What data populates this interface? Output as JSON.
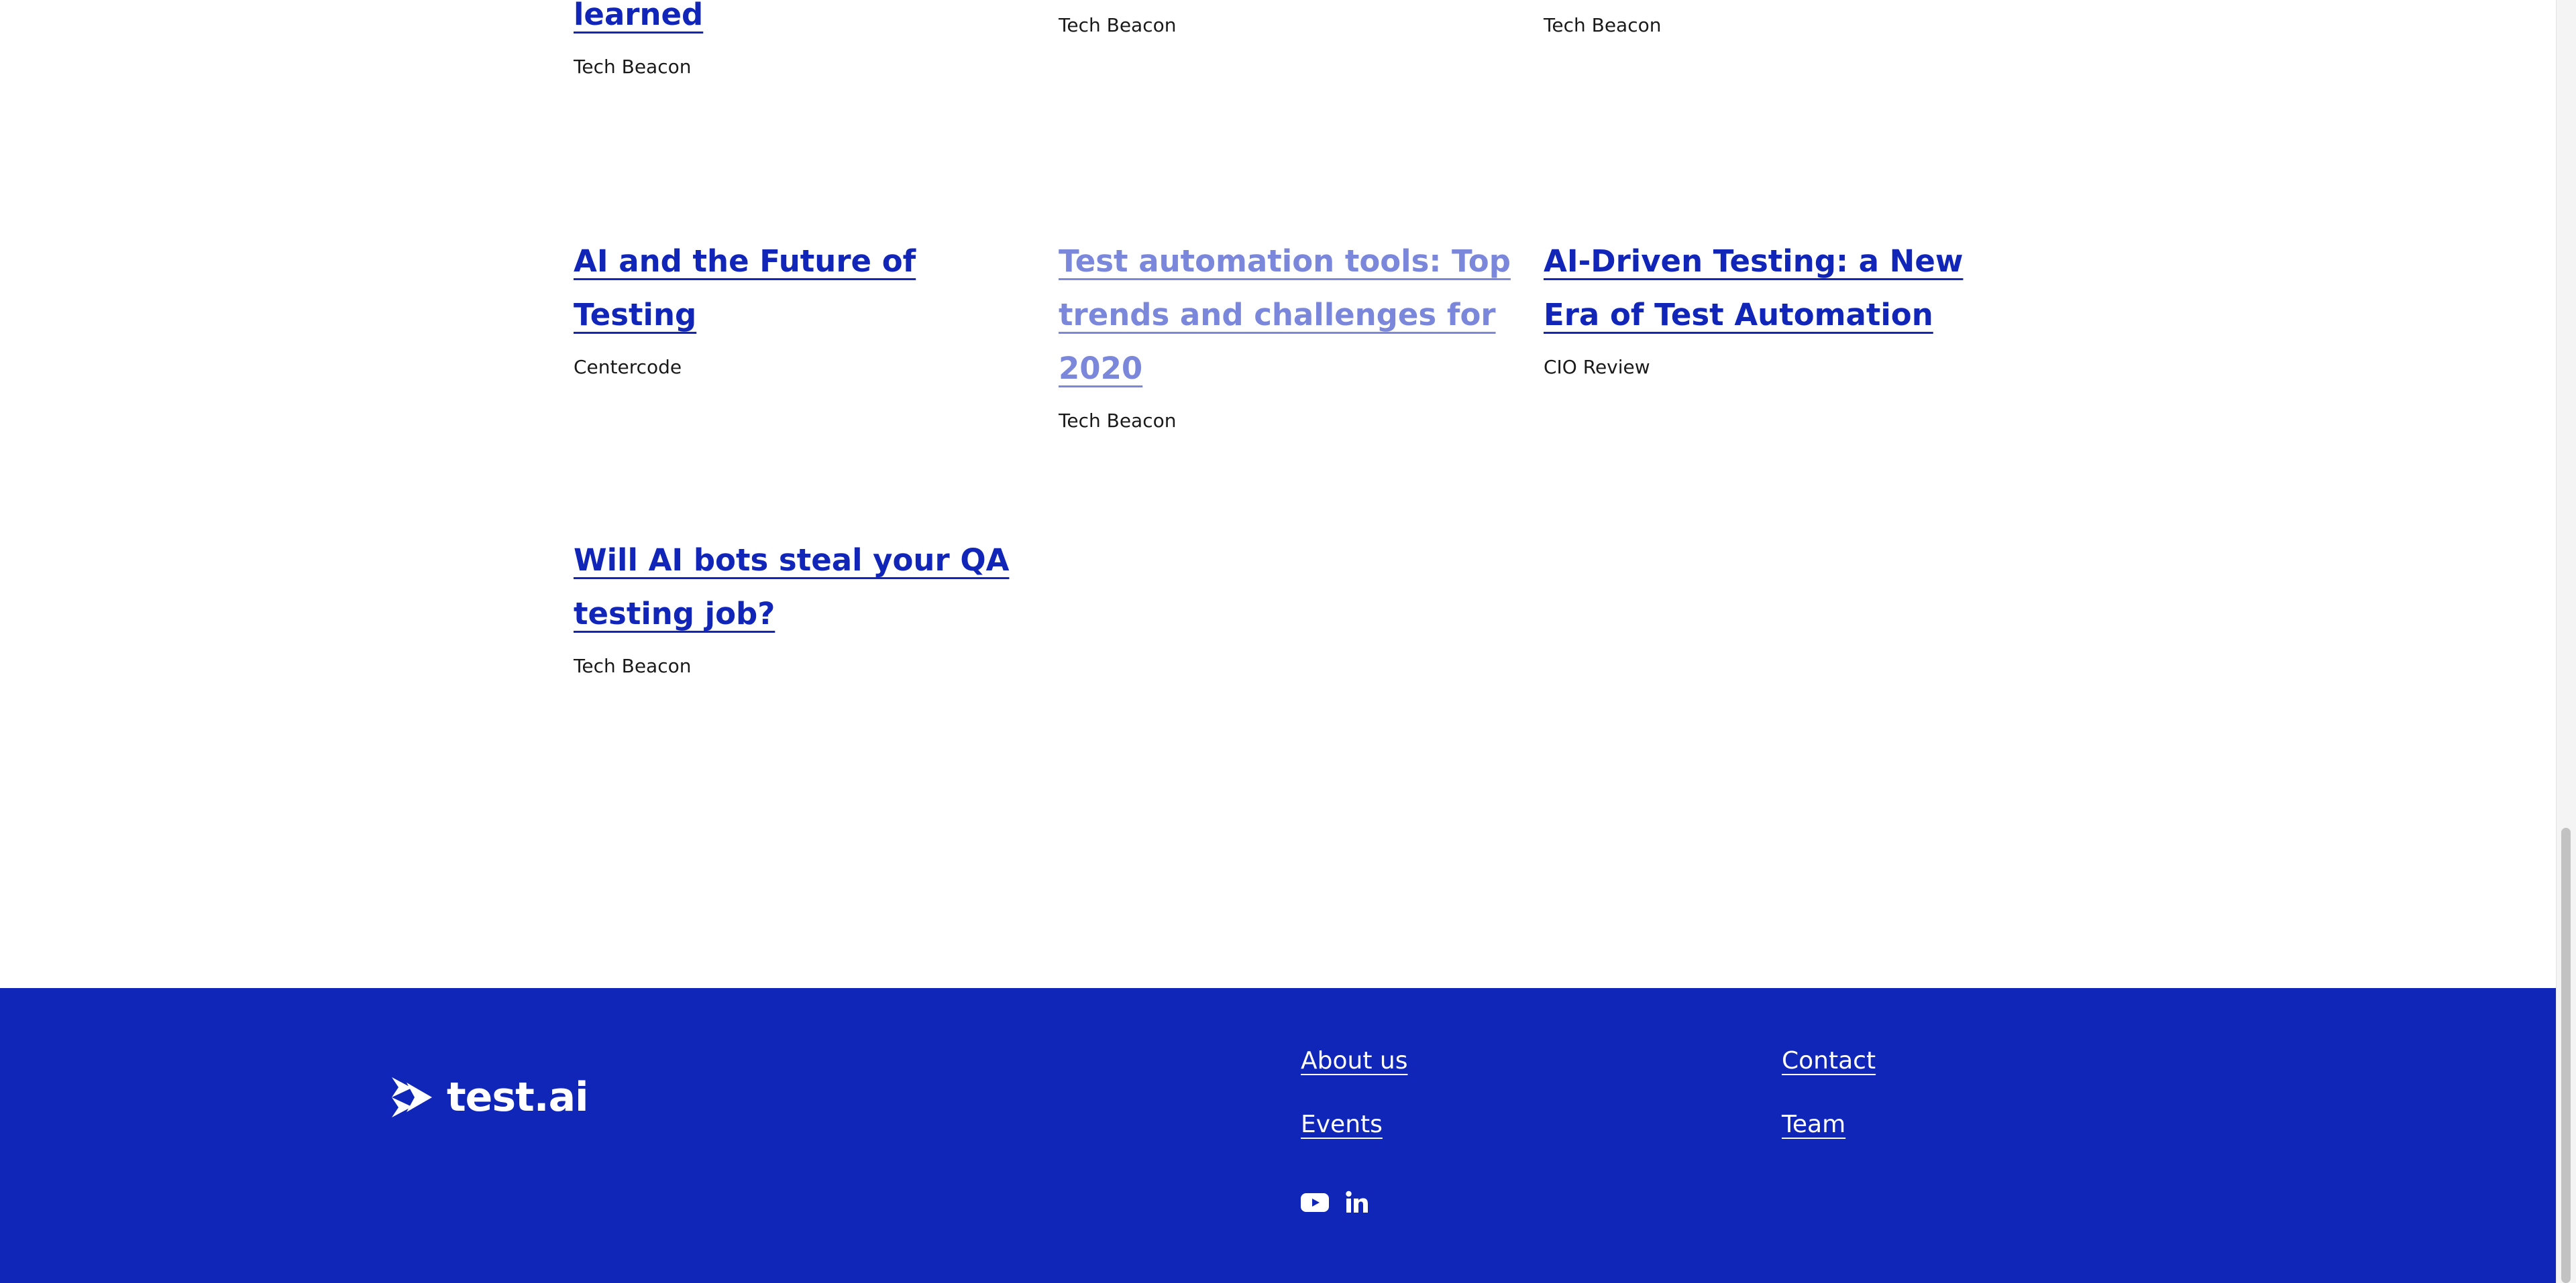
{
  "articles": [
    {
      "title": "learned",
      "source": "Tech Beacon"
    },
    {
      "title": "",
      "source": "Tech Beacon"
    },
    {
      "title": "",
      "source": "Tech Beacon"
    },
    {
      "title": "AI and the Future of Testing",
      "source": "Centercode"
    },
    {
      "title": "Test automation tools: Top trends and challenges for 2020",
      "source": "Tech Beacon",
      "visited": true
    },
    {
      "title": "AI-Driven Testing: a New Era of Test Automation",
      "source": "CIO Review"
    },
    {
      "title": "Will AI bots steal your QA testing job?",
      "source": "Tech Beacon"
    }
  ],
  "footer": {
    "logo_text": "test.ai",
    "links": {
      "about": "About us",
      "events": "Events",
      "contact": "Contact",
      "team": "Team"
    },
    "social": [
      "youtube-icon",
      "linkedin-icon"
    ]
  },
  "colors": {
    "link": "#1126b8",
    "visited_link": "#7b87da",
    "footer_bg": "#1026b8"
  }
}
